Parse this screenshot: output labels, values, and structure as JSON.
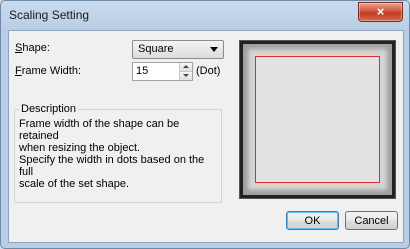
{
  "window": {
    "title": "Scaling Setting",
    "close_symbol": "×"
  },
  "shape": {
    "label_accel": "S",
    "label_rest": "hape:",
    "selected": "Square"
  },
  "frame_width": {
    "label_accel": "F",
    "label_rest": "rame Width:",
    "value": "15",
    "unit": "(Dot)"
  },
  "description": {
    "title": "Description",
    "text": "Frame width of the shape can be retained\nwhen resizing the object.\nSpecify the width in dots based on the full\nscale of the set shape."
  },
  "preview": {
    "frame_color": "#e12a2a"
  },
  "buttons": {
    "ok": "OK",
    "cancel": "Cancel"
  }
}
